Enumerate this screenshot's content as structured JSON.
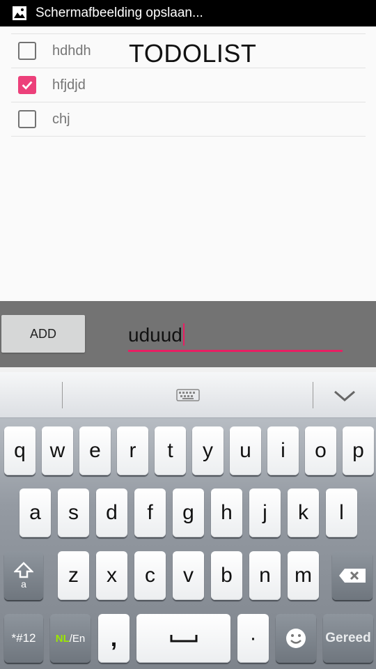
{
  "status_bar": {
    "notification": "Schermafbeelding opslaan...",
    "icon": "image-icon"
  },
  "app": {
    "title": "TODOLIST"
  },
  "todos": [
    {
      "label": "hdhdh",
      "checked": false
    },
    {
      "label": "hfjdjd",
      "checked": true
    },
    {
      "label": "chj",
      "checked": false
    }
  ],
  "add_bar": {
    "button_label": "ADD",
    "input_value": "uduud"
  },
  "keyboard": {
    "row1": [
      "q",
      "w",
      "e",
      "r",
      "t",
      "y",
      "u",
      "i",
      "o",
      "p"
    ],
    "row2": [
      "a",
      "s",
      "d",
      "f",
      "g",
      "h",
      "j",
      "k",
      "l"
    ],
    "row3": [
      "z",
      "x",
      "c",
      "v",
      "b",
      "n",
      "m"
    ],
    "shift_sub": "a",
    "symbols": "*#12",
    "lang_nl": "NL",
    "lang_en": "/En",
    "comma": ",",
    "period": "·",
    "done": "Gereed"
  },
  "colors": {
    "accent": "#e91e63",
    "checkbox_checked": "#ec407a",
    "add_bar_bg": "#737373"
  }
}
